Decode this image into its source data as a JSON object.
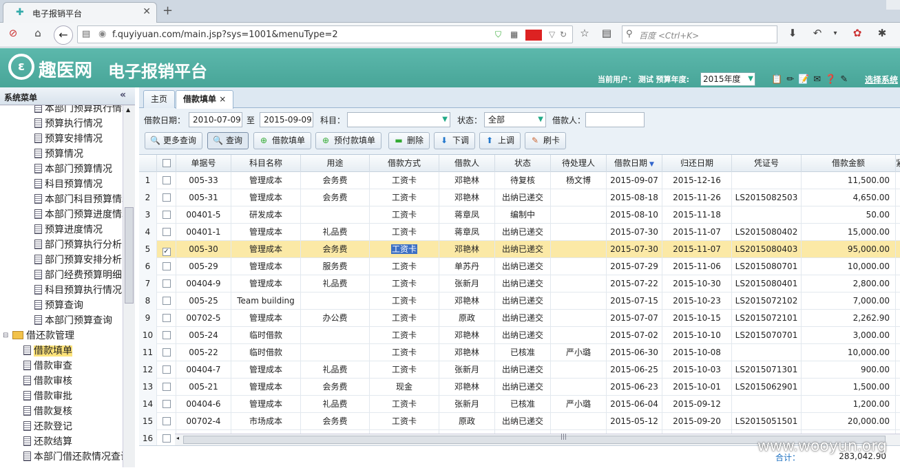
{
  "browser": {
    "tab_title": "电子报销平台",
    "url": "f.quyiyuan.com/main.jsp?sys=1001&menuType=2",
    "search_placeholder": "百度 <Ctrl+K>"
  },
  "header": {
    "brand": "趣医网",
    "app_title": "电子报销平台",
    "user_label": "当前用户： 测试 预算年度:",
    "year": "2015年度",
    "switch_label": "选择系统"
  },
  "sidebar": {
    "title": "系统菜单",
    "collapse": "«",
    "items": [
      {
        "label": "本部门预算执行情况"
      },
      {
        "label": "预算执行情况"
      },
      {
        "label": "预算安排情况"
      },
      {
        "label": "预算情况"
      },
      {
        "label": "本部门预算情况"
      },
      {
        "label": "科目预算情况"
      },
      {
        "label": "本部门科目预算情况"
      },
      {
        "label": "本部门预算进度情况"
      },
      {
        "label": "预算进度情况"
      },
      {
        "label": "部门预算执行分析"
      },
      {
        "label": "部门预算安排分析"
      },
      {
        "label": "部门经费预算明细"
      },
      {
        "label": "科目预算执行情况"
      },
      {
        "label": "预算查询"
      },
      {
        "label": "本部门预算查询"
      },
      {
        "label": "借还款管理"
      },
      {
        "label": "借款填单"
      },
      {
        "label": "借款审查"
      },
      {
        "label": "借款审核"
      },
      {
        "label": "借款审批"
      },
      {
        "label": "借款复核"
      },
      {
        "label": "还款登记"
      },
      {
        "label": "还款结算"
      },
      {
        "label": "本部门借还款情况查询"
      }
    ]
  },
  "tabs": [
    {
      "label": "主页"
    },
    {
      "label": "借款填单",
      "close": "×"
    }
  ],
  "filters": {
    "date_label": "借款日期：",
    "date_from": "2010-07-09",
    "to_label": "至",
    "date_to": "2015-09-09",
    "subject_label": "科目：",
    "subject_value": "",
    "status_label": "状态：",
    "status_value": "全部",
    "borrower_label": "借款人：",
    "borrower_value": ""
  },
  "buttons": [
    {
      "label": "更多查询",
      "icon": "🔍"
    },
    {
      "label": "查询",
      "icon": "🔍"
    },
    {
      "label": "借款填单",
      "icon": "⊕"
    },
    {
      "label": "预付款填单",
      "icon": "⊕"
    },
    {
      "label": "删除",
      "icon": "▬"
    },
    {
      "label": "下调",
      "icon": "⬇"
    },
    {
      "label": "上调",
      "icon": "⬆"
    },
    {
      "label": "刷卡",
      "icon": "✎"
    }
  ],
  "columns": [
    "",
    "单据号",
    "科目名称",
    "用途",
    "借款方式",
    "借款人",
    "状态",
    "待处理人",
    "借款日期",
    "归还日期",
    "凭证号",
    "借款金额",
    "紧急"
  ],
  "sort_indicator": "▼",
  "rows": [
    {
      "n": "1",
      "checked": "",
      "no": "005-33",
      "subject": "管理成本",
      "use": "会务费",
      "method": "工资卡",
      "person": "邓艳林",
      "status": "待复核",
      "handler": "杨文博",
      "date": "2015-09-07",
      "ret": "2015-12-16",
      "voucher": "",
      "amount": "11,500.00"
    },
    {
      "n": "2",
      "checked": "",
      "no": "005-31",
      "subject": "管理成本",
      "use": "会务费",
      "method": "工资卡",
      "person": "邓艳林",
      "status": "出纳已递交",
      "handler": "",
      "date": "2015-08-18",
      "ret": "2015-11-26",
      "voucher": "LS2015082503",
      "amount": "4,650.00"
    },
    {
      "n": "3",
      "checked": "",
      "no": "00401-5",
      "subject": "研发成本",
      "use": "",
      "method": "工资卡",
      "person": "蒋章凤",
      "status": "编制中",
      "handler": "",
      "date": "2015-08-10",
      "ret": "2015-11-18",
      "voucher": "",
      "amount": "50.00"
    },
    {
      "n": "4",
      "checked": "",
      "no": "00401-1",
      "subject": "管理成本",
      "use": "礼品费",
      "method": "工资卡",
      "person": "蒋章凤",
      "status": "出纳已递交",
      "handler": "",
      "date": "2015-07-30",
      "ret": "2015-11-07",
      "voucher": "LS2015080402",
      "amount": "15,000.00"
    },
    {
      "n": "5",
      "checked": "✓",
      "no": "005-30",
      "subject": "管理成本",
      "use": "会务费",
      "method": "工资卡",
      "person": "邓艳林",
      "status": "出纳已递交",
      "handler": "",
      "date": "2015-07-30",
      "ret": "2015-11-07",
      "voucher": "LS2015080403",
      "amount": "95,000.00",
      "sel": true
    },
    {
      "n": "6",
      "checked": "",
      "no": "005-29",
      "subject": "管理成本",
      "use": "服务费",
      "method": "工资卡",
      "person": "单苏丹",
      "status": "出纳已递交",
      "handler": "",
      "date": "2015-07-29",
      "ret": "2015-11-06",
      "voucher": "LS2015080701",
      "amount": "10,000.00"
    },
    {
      "n": "7",
      "checked": "",
      "no": "00404-9",
      "subject": "管理成本",
      "use": "礼品费",
      "method": "工资卡",
      "person": "张新月",
      "status": "出纳已递交",
      "handler": "",
      "date": "2015-07-22",
      "ret": "2015-10-30",
      "voucher": "LS2015080401",
      "amount": "2,800.00"
    },
    {
      "n": "8",
      "checked": "",
      "no": "005-25",
      "subject": "Team building",
      "use": "",
      "method": "工资卡",
      "person": "邓艳林",
      "status": "出纳已递交",
      "handler": "",
      "date": "2015-07-15",
      "ret": "2015-10-23",
      "voucher": "LS2015072102",
      "amount": "7,000.00"
    },
    {
      "n": "9",
      "checked": "",
      "no": "00702-5",
      "subject": "管理成本",
      "use": "办公费",
      "method": "工资卡",
      "person": "原政",
      "status": "出纳已递交",
      "handler": "",
      "date": "2015-07-07",
      "ret": "2015-10-15",
      "voucher": "LS2015072101",
      "amount": "2,262.90"
    },
    {
      "n": "10",
      "checked": "",
      "no": "005-24",
      "subject": "临时借款",
      "use": "",
      "method": "工资卡",
      "person": "邓艳林",
      "status": "出纳已递交",
      "handler": "",
      "date": "2015-07-02",
      "ret": "2015-10-10",
      "voucher": "LS2015070701",
      "amount": "3,000.00"
    },
    {
      "n": "11",
      "checked": "",
      "no": "005-22",
      "subject": "临时借款",
      "use": "",
      "method": "工资卡",
      "person": "邓艳林",
      "status": "已核准",
      "handler": "严小璐",
      "date": "2015-06-30",
      "ret": "2015-10-08",
      "voucher": "",
      "amount": "10,000.00"
    },
    {
      "n": "12",
      "checked": "",
      "no": "00404-7",
      "subject": "管理成本",
      "use": "礼品费",
      "method": "工资卡",
      "person": "张新月",
      "status": "出纳已递交",
      "handler": "",
      "date": "2015-06-25",
      "ret": "2015-10-03",
      "voucher": "LS2015071301",
      "amount": "900.00"
    },
    {
      "n": "13",
      "checked": "",
      "no": "005-21",
      "subject": "管理成本",
      "use": "会务费",
      "method": "现金",
      "person": "邓艳林",
      "status": "出纳已递交",
      "handler": "",
      "date": "2015-06-23",
      "ret": "2015-10-01",
      "voucher": "LS2015062901",
      "amount": "1,500.00"
    },
    {
      "n": "14",
      "checked": "",
      "no": "00404-6",
      "subject": "管理成本",
      "use": "礼品费",
      "method": "工资卡",
      "person": "张新月",
      "status": "已核准",
      "handler": "严小璐",
      "date": "2015-06-04",
      "ret": "2015-09-12",
      "voucher": "",
      "amount": "1,200.00"
    },
    {
      "n": "15",
      "checked": "",
      "no": "00702-4",
      "subject": "市场成本",
      "use": "会务费",
      "method": "工资卡",
      "person": "原政",
      "status": "出纳已递交",
      "handler": "",
      "date": "2015-05-12",
      "ret": "2015-09-20",
      "voucher": "LS2015051501",
      "amount": "20,000.00"
    },
    {
      "n": "16",
      "checked": "",
      "no": "",
      "subject": "",
      "use": "",
      "method": "",
      "person": "",
      "status": "",
      "handler": "",
      "date": "",
      "ret": "",
      "voucher": "",
      "amount": ""
    }
  ],
  "footer": {
    "total_label": "合计：",
    "total_value": "283,042.90"
  },
  "watermark": "www.wooyun.org"
}
